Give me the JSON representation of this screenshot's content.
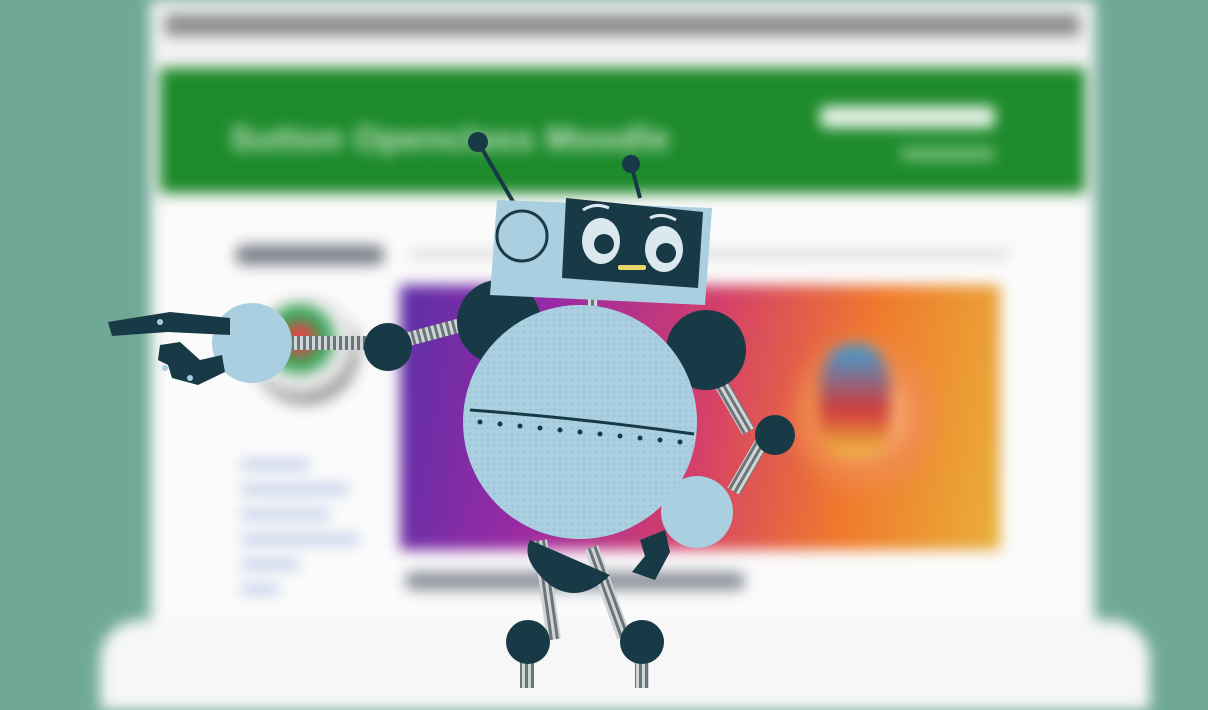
{
  "scene": {
    "background_title": "Sutton Openclass Moodle",
    "colors": {
      "backdrop": "#6fa996",
      "header_green": "#1d8a2b",
      "robot_light": "#a9cfe0",
      "robot_dark": "#173a46"
    },
    "icons": {
      "character": "robot-mascot"
    }
  }
}
